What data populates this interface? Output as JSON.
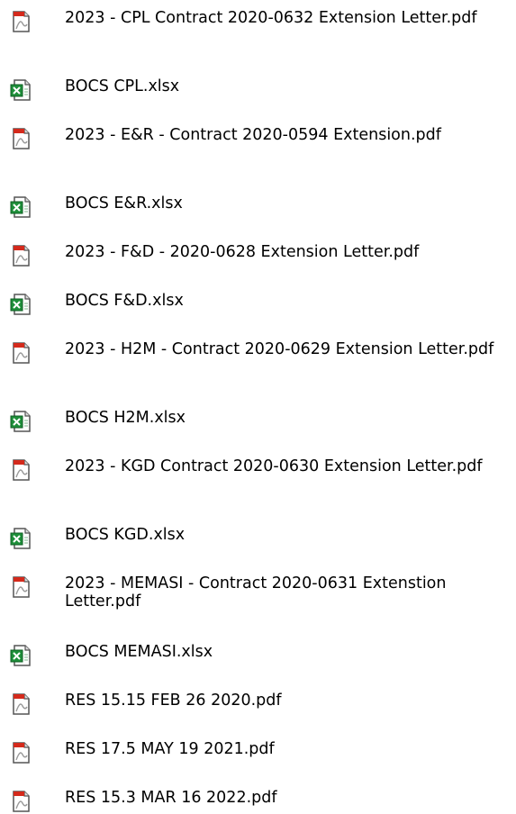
{
  "files": [
    {
      "name": "2023 - CPL Contract 2020-0632 Extension Letter.pdf",
      "icon": "pdf-file-icon"
    },
    {
      "name": "BOCS CPL.xlsx",
      "icon": "excel-file-icon"
    },
    {
      "name": "2023 - E&R - Contract 2020-0594 Extension.pdf",
      "icon": "pdf-file-icon"
    },
    {
      "name": "BOCS E&R.xlsx",
      "icon": "excel-file-icon"
    },
    {
      "name": "2023 - F&D - 2020-0628 Extension Letter.pdf",
      "icon": "pdf-file-icon"
    },
    {
      "name": "BOCS F&D.xlsx",
      "icon": "excel-file-icon"
    },
    {
      "name": "2023 - H2M - Contract 2020-0629 Extension Letter.pdf",
      "icon": "pdf-file-icon"
    },
    {
      "name": "BOCS H2M.xlsx",
      "icon": "excel-file-icon"
    },
    {
      "name": "2023 - KGD Contract 2020-0630 Extension Letter.pdf",
      "icon": "pdf-file-icon"
    },
    {
      "name": "BOCS KGD.xlsx",
      "icon": "excel-file-icon"
    },
    {
      "name": "2023 - MEMASI - Contract 2020-0631 Extenstion Letter.pdf",
      "icon": "pdf-file-icon"
    },
    {
      "name": "BOCS MEMASI.xlsx",
      "icon": "excel-file-icon"
    },
    {
      "name": "RES 15.15 FEB 26 2020.pdf",
      "icon": "pdf-file-icon"
    },
    {
      "name": "RES 17.5 MAY 19 2021.pdf",
      "icon": "pdf-file-icon"
    },
    {
      "name": "RES 15.3 MAR 16 2022.pdf",
      "icon": "pdf-file-icon"
    }
  ]
}
